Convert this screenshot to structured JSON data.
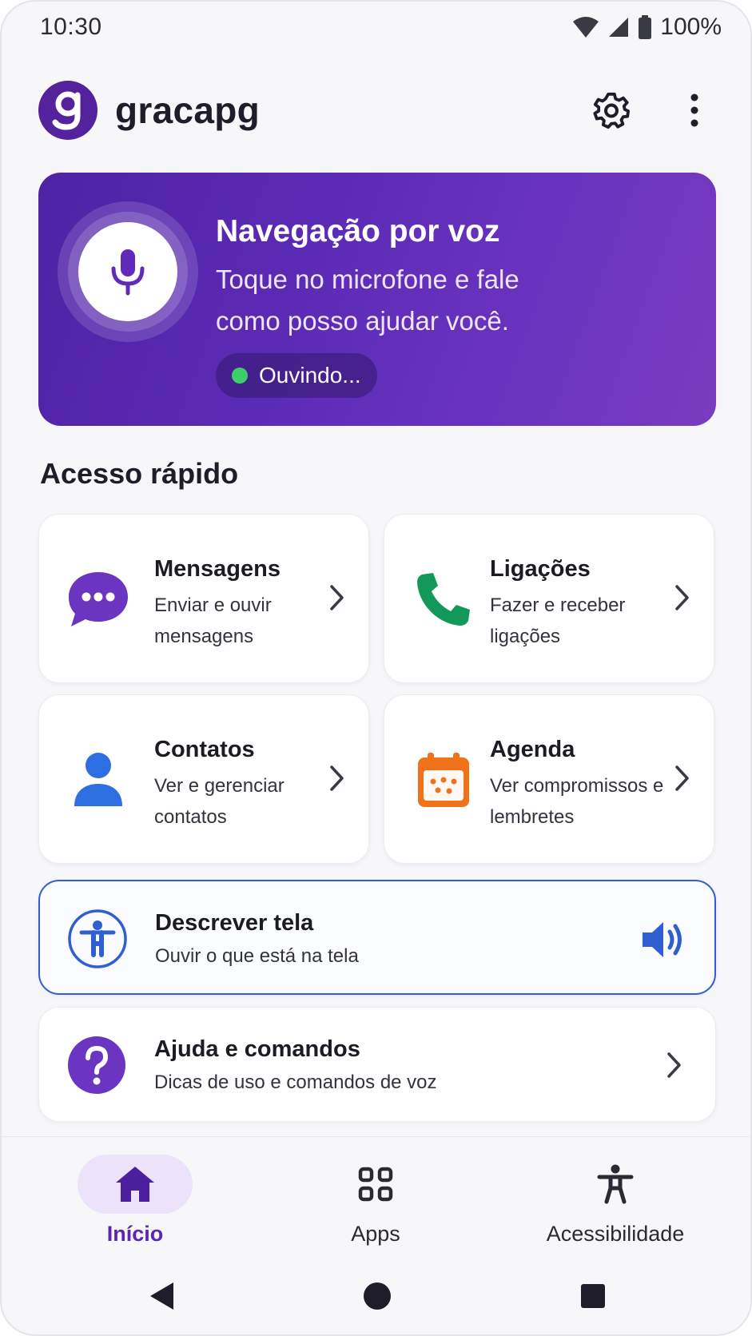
{
  "status_bar": {
    "time": "10:30",
    "battery": "100%",
    "icons": [
      "wifi-icon",
      "signal-icon",
      "battery-icon"
    ]
  },
  "header": {
    "app_name": "gracapg",
    "logo_letter": "g",
    "icons": [
      "settings-gear-icon",
      "more-vertical-icon"
    ]
  },
  "voice": {
    "title": "Navegação por voz",
    "description": "Toque no microfone e fale como posso ajudar você.",
    "status": "Ouvindo...",
    "icon": "microphone-icon"
  },
  "quick_access": {
    "title": "Acesso rápido",
    "cards": [
      {
        "title": "Mensagens",
        "subtitle": "Enviar e ouvir mensagens",
        "icon": "message-bubble-icon",
        "color": "#6b35c2"
      },
      {
        "title": "Ligações",
        "subtitle": "Fazer e receber ligações",
        "icon": "phone-icon",
        "color": "#12995a"
      },
      {
        "title": "Contatos",
        "subtitle": "Ver e gerenciar contatos",
        "icon": "person-icon",
        "color": "#2d6ee0"
      },
      {
        "title": "Agenda",
        "subtitle": "Ver compromissos e lembretes",
        "icon": "calendar-icon",
        "color": "#f0721a"
      }
    ]
  },
  "describe_screen": {
    "title": "Descrever tela",
    "subtitle": "Ouvir o que está na tela",
    "icon": "accessibility-icon",
    "action_icon": "speaker-icon",
    "color": "#2f5fd0"
  },
  "help": {
    "title": "Ajuda e comandos",
    "subtitle": "Dicas de uso e comandos de voz",
    "icon": "question-icon",
    "color": "#6b35c2"
  },
  "bottom_nav": {
    "items": [
      {
        "label": "Início",
        "icon": "home-icon",
        "active": true
      },
      {
        "label": "Apps",
        "icon": "apps-grid-icon",
        "active": false
      },
      {
        "label": "Acessibilidade",
        "icon": "accessibility-person-icon",
        "active": false
      }
    ]
  },
  "system_nav": [
    "back-triangle-icon",
    "home-circle-icon",
    "recents-square-icon"
  ],
  "colors": {
    "primary": "#5b25b5",
    "banner_start": "#4f22a4",
    "banner_end": "#7a3cc0",
    "listening_dot": "#3ecf6b"
  }
}
